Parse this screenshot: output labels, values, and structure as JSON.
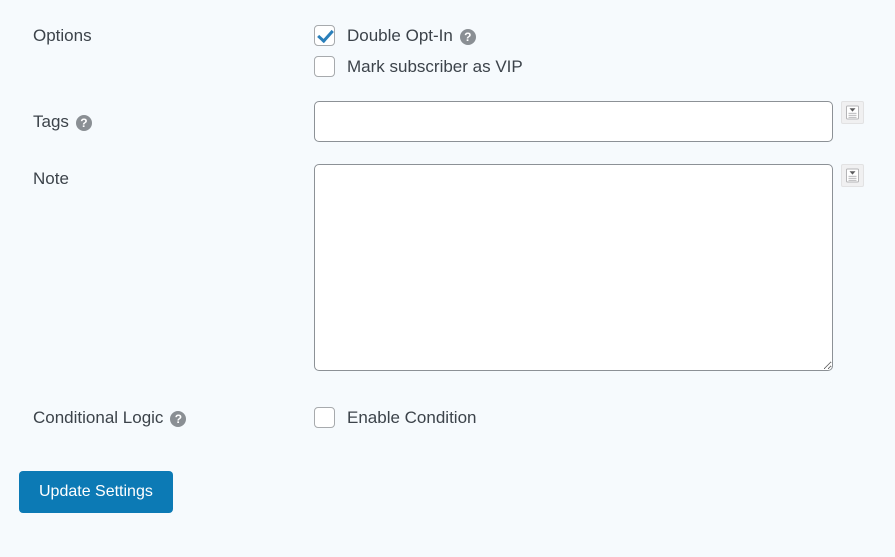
{
  "form": {
    "rows": {
      "options": {
        "label": "Options",
        "checkboxes": [
          {
            "label": "Double Opt-In",
            "checked": true,
            "help": "?"
          },
          {
            "label": "Mark subscriber as VIP",
            "checked": false
          }
        ]
      },
      "tags": {
        "label": "Tags",
        "help": "?",
        "value": "",
        "placeholder": "",
        "smartcode_icon": "smartcode-icon"
      },
      "note": {
        "label": "Note",
        "value": "",
        "placeholder": "",
        "smartcode_icon": "smartcode-icon"
      },
      "conditional_logic": {
        "label": "Conditional Logic",
        "help": "?",
        "checkbox": {
          "label": "Enable Condition",
          "checked": false
        }
      }
    },
    "submit": {
      "label": "Update Settings"
    }
  },
  "colors": {
    "page_background": "#f6fafd",
    "text": "#3c434a",
    "primary_button": "#0c7ab5",
    "checkmark": "#2a7fba",
    "input_border": "#8c9196",
    "help_icon": "#8a8f94"
  }
}
